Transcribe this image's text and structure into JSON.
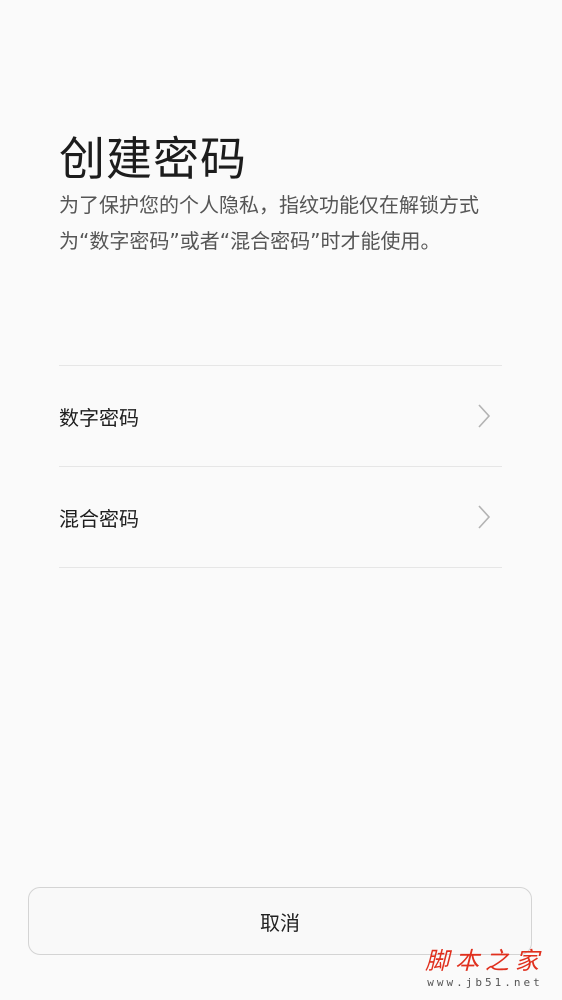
{
  "header": {
    "title": "创建密码",
    "description": "为了保护您的个人隐私，指纹功能仅在解锁方式为“数字密码”或者“混合密码”时才能使用。"
  },
  "options": [
    {
      "label": "数字密码",
      "icon": "chevron-right-icon"
    },
    {
      "label": "混合密码",
      "icon": "chevron-right-icon"
    }
  ],
  "footer": {
    "cancel_label": "取消"
  },
  "watermark": {
    "main": "脚本之家",
    "sub": "www.jb51.net"
  },
  "colors": {
    "background": "#fafafa",
    "divider": "#e6e6e6",
    "chevron": "#b3b3b3",
    "watermark": "#e0301e"
  }
}
